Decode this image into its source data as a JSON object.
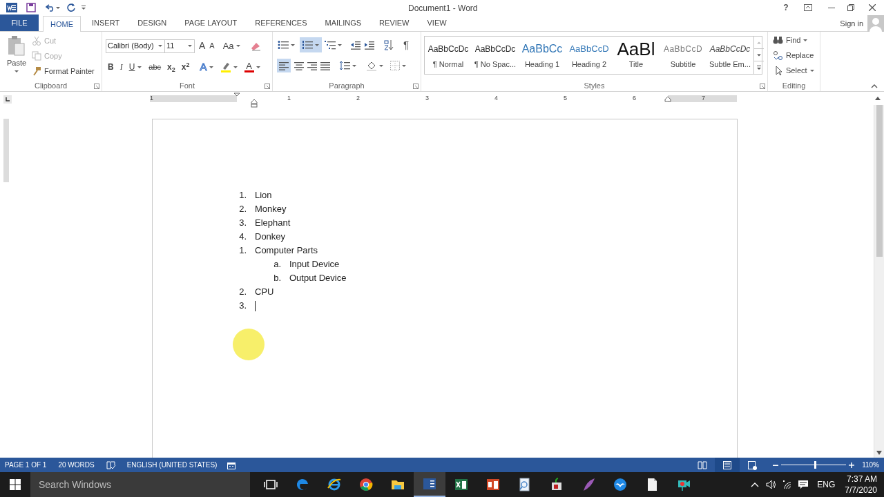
{
  "window": {
    "title": "Document1 - Word",
    "help": "?",
    "sign_in": "Sign in"
  },
  "tabs": [
    {
      "label": "FILE",
      "kind": "file",
      "selected": false
    },
    {
      "label": "HOME",
      "kind": "tab",
      "selected": true
    },
    {
      "label": "INSERT",
      "kind": "tab",
      "selected": false
    },
    {
      "label": "DESIGN",
      "kind": "tab",
      "selected": false
    },
    {
      "label": "PAGE LAYOUT",
      "kind": "tab",
      "selected": false
    },
    {
      "label": "REFERENCES",
      "kind": "tab",
      "selected": false
    },
    {
      "label": "MAILINGS",
      "kind": "tab",
      "selected": false
    },
    {
      "label": "REVIEW",
      "kind": "tab",
      "selected": false
    },
    {
      "label": "VIEW",
      "kind": "tab",
      "selected": false
    }
  ],
  "clipboard": {
    "label": "Clipboard",
    "paste": "Paste",
    "cut": {
      "label": "Cut",
      "disabled": true
    },
    "copy": {
      "label": "Copy",
      "disabled": true
    },
    "format_painter": {
      "label": "Format Painter",
      "disabled": false
    }
  },
  "font": {
    "label": "Font",
    "font_name": "Calibri (Body)",
    "font_size": "11",
    "grow": "A",
    "shrink": "A",
    "change_case": "Aa",
    "bold": "B",
    "italic": "I",
    "underline": "U",
    "strikethrough": "abc",
    "subscript": "x$_{2}$",
    "superscript": "x$^{2}$",
    "text_effects": "A",
    "font_color": "A"
  },
  "paragraph": {
    "label": "Paragraph",
    "numbering_on": true,
    "align_left_on": true,
    "pilcrow": "¶"
  },
  "styles": {
    "label": "Styles",
    "items": [
      {
        "preview": "AaBbCcDc",
        "name": "¶ Normal",
        "kind": "normal"
      },
      {
        "preview": "AaBbCcDc",
        "name": "¶ No Spac...",
        "kind": "normal"
      },
      {
        "preview": "AaBbCc",
        "name": "Heading 1",
        "kind": "heading1"
      },
      {
        "preview": "AaBbCcD",
        "name": "Heading 2",
        "kind": "heading2"
      },
      {
        "preview": "AaBl",
        "name": "Title",
        "kind": "title"
      },
      {
        "preview": "AaBbCcD",
        "name": "Subtitle",
        "kind": "subtitle"
      },
      {
        "preview": "AaBbCcDc",
        "name": "Subtle Em...",
        "kind": "emphasis"
      }
    ]
  },
  "editing": {
    "label": "Editing",
    "find": "Find",
    "replace": "Replace",
    "select": "Select"
  },
  "ruler": {
    "numbers": [
      "1",
      "1",
      "2",
      "3",
      "4",
      "5",
      "6",
      "7"
    ]
  },
  "document": {
    "list": [
      {
        "number": "1.",
        "text": "Lion"
      },
      {
        "number": "2.",
        "text": "Monkey"
      },
      {
        "number": "3.",
        "text": "Elephant"
      },
      {
        "number": "4.",
        "text": "Donkey"
      },
      {
        "number": "1.",
        "text": "Computer Parts",
        "children": [
          {
            "number": "a.",
            "text": "Input Device"
          },
          {
            "number": "b.",
            "text": "Output Device"
          }
        ]
      },
      {
        "number": "2.",
        "text": "CPU"
      },
      {
        "number": "3.",
        "text_cursor": true
      }
    ]
  },
  "status_bar": {
    "page": "PAGE 1 OF 1",
    "words": "20 WORDS",
    "language": "ENGLISH (UNITED STATES)",
    "views": [
      {
        "kind": "read",
        "selected": false
      },
      {
        "kind": "print",
        "selected": true
      },
      {
        "kind": "web",
        "selected": false
      }
    ],
    "zoom_slider": {
      "level": 0.53
    },
    "zoom": "110%"
  },
  "taskbar": {
    "search_placeholder": "Search Windows",
    "apps": [
      {
        "kind": "taskview",
        "selected": false
      },
      {
        "kind": "edge",
        "selected": false
      },
      {
        "kind": "ie",
        "selected": false
      },
      {
        "kind": "chrome",
        "selected": false
      },
      {
        "kind": "folder",
        "selected": false
      },
      {
        "kind": "word",
        "selected": true
      },
      {
        "kind": "excel",
        "selected": false
      },
      {
        "kind": "powerpoint",
        "selected": false
      },
      {
        "kind": "search",
        "selected": false
      },
      {
        "kind": "setup",
        "selected": false
      },
      {
        "kind": "feather",
        "selected": false
      },
      {
        "kind": "bird",
        "selected": false
      },
      {
        "kind": "file",
        "selected": false
      },
      {
        "kind": "camera",
        "selected": false
      }
    ],
    "language": "ENG",
    "time": "7:37 AM",
    "date": "7/7/2020"
  }
}
